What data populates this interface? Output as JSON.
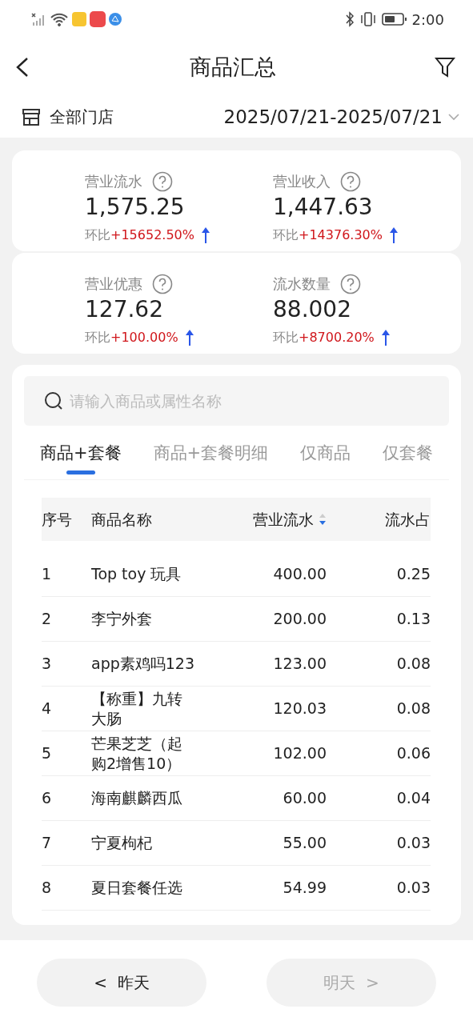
{
  "status_bar": {
    "time": "2:00"
  },
  "header": {
    "title": "商品汇总"
  },
  "filter_bar": {
    "store": "全部门店",
    "date_range": "2025/07/21-2025/07/21"
  },
  "metric_cards": [
    {
      "metrics": [
        {
          "label": "营业流水",
          "value": "1,575.25",
          "compare_label": "环比",
          "change": "+15652.50%",
          "rising": true
        },
        {
          "label": "营业收入",
          "value": "1,447.63",
          "compare_label": "环比",
          "change": "+14376.30%",
          "rising": true
        }
      ]
    },
    {
      "metrics": [
        {
          "label": "营业优惠",
          "value": "127.62",
          "compare_label": "环比",
          "change": "+100.00%",
          "rising": true
        },
        {
          "label": "流水数量",
          "value": "88.002",
          "compare_label": "环比",
          "change": "+8700.20%",
          "rising": true
        }
      ]
    }
  ],
  "search": {
    "placeholder": "请输入商品或属性名称"
  },
  "tabs": [
    {
      "label": "商品+套餐",
      "selected": true
    },
    {
      "label": "商品+套餐明细",
      "selected": false
    },
    {
      "label": "仅商品",
      "selected": false
    },
    {
      "label": "仅套餐",
      "selected": false
    }
  ],
  "table": {
    "columns": [
      {
        "label": "序号"
      },
      {
        "label": "商品名称"
      },
      {
        "label": "营业流水",
        "sorted_descending": true
      },
      {
        "label": "流水占"
      }
    ],
    "rows": [
      [
        "1",
        "Top toy 玩具",
        "400.00",
        "0.25"
      ],
      [
        "2",
        "李宁外套",
        "200.00",
        "0.13"
      ],
      [
        "3",
        "app素鸡吗123",
        "123.00",
        "0.08"
      ],
      [
        "4",
        "【称重】九转大肠",
        "120.03",
        "0.08"
      ],
      [
        "5",
        "芒果芝芝（起购2增售10）",
        "102.00",
        "0.06"
      ],
      [
        "6",
        "海南麒麟西瓜",
        "60.00",
        "0.04"
      ],
      [
        "7",
        "宁夏枸杞",
        "55.00",
        "0.03"
      ],
      [
        "8",
        "夏日套餐任选",
        "54.99",
        "0.03"
      ]
    ]
  },
  "footer": {
    "buttons": [
      {
        "label": "<  昨天",
        "disabled": false
      },
      {
        "label": "明天  >",
        "disabled": true
      }
    ]
  }
}
